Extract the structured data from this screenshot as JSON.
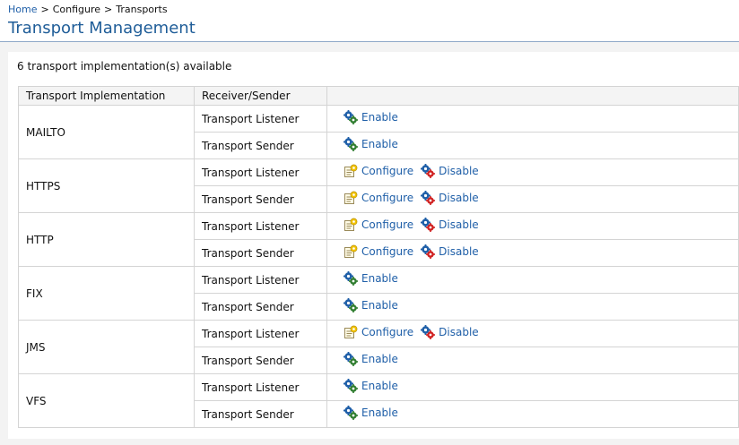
{
  "breadcrumb": {
    "home": "Home",
    "separator": ">",
    "configure": "Configure",
    "current": "Transports"
  },
  "page_title": "Transport Management",
  "summary": "6 transport implementation(s) available",
  "table": {
    "headers": [
      "Transport Implementation",
      "Receiver/Sender",
      ""
    ],
    "rows": [
      {
        "name": "MAILTO",
        "listener": {
          "label": "Transport Listener",
          "actions": [
            {
              "label": "Enable",
              "icon": "enable-gears-icon"
            }
          ]
        },
        "sender": {
          "label": "Transport Sender",
          "actions": [
            {
              "label": "Enable",
              "icon": "enable-gears-icon"
            }
          ]
        }
      },
      {
        "name": "HTTPS",
        "listener": {
          "label": "Transport Listener",
          "actions": [
            {
              "label": "Configure",
              "icon": "configure-icon"
            },
            {
              "label": "Disable",
              "icon": "disable-gears-icon"
            }
          ]
        },
        "sender": {
          "label": "Transport Sender",
          "actions": [
            {
              "label": "Configure",
              "icon": "configure-icon"
            },
            {
              "label": "Disable",
              "icon": "disable-gears-icon"
            }
          ]
        }
      },
      {
        "name": "HTTP",
        "listener": {
          "label": "Transport Listener",
          "actions": [
            {
              "label": "Configure",
              "icon": "configure-icon"
            },
            {
              "label": "Disable",
              "icon": "disable-gears-icon"
            }
          ]
        },
        "sender": {
          "label": "Transport Sender",
          "actions": [
            {
              "label": "Configure",
              "icon": "configure-icon"
            },
            {
              "label": "Disable",
              "icon": "disable-gears-icon"
            }
          ]
        }
      },
      {
        "name": "FIX",
        "listener": {
          "label": "Transport Listener",
          "actions": [
            {
              "label": "Enable",
              "icon": "enable-gears-icon"
            }
          ]
        },
        "sender": {
          "label": "Transport Sender",
          "actions": [
            {
              "label": "Enable",
              "icon": "enable-gears-icon"
            }
          ]
        }
      },
      {
        "name": "JMS",
        "listener": {
          "label": "Transport Listener",
          "actions": [
            {
              "label": "Configure",
              "icon": "configure-icon"
            },
            {
              "label": "Disable",
              "icon": "disable-gears-icon"
            }
          ]
        },
        "sender": {
          "label": "Transport Sender",
          "actions": [
            {
              "label": "Enable",
              "icon": "enable-gears-icon"
            }
          ]
        }
      },
      {
        "name": "VFS",
        "listener": {
          "label": "Transport Listener",
          "actions": [
            {
              "label": "Enable",
              "icon": "enable-gears-icon"
            }
          ]
        },
        "sender": {
          "label": "Transport Sender",
          "actions": [
            {
              "label": "Enable",
              "icon": "enable-gears-icon"
            }
          ]
        }
      }
    ]
  },
  "colors": {
    "link": "#1f5fa8",
    "title": "#1f5d98",
    "enable_gear": "#2f7d2f",
    "disable_gear": "#d02020",
    "border": "#d4d4d4"
  }
}
